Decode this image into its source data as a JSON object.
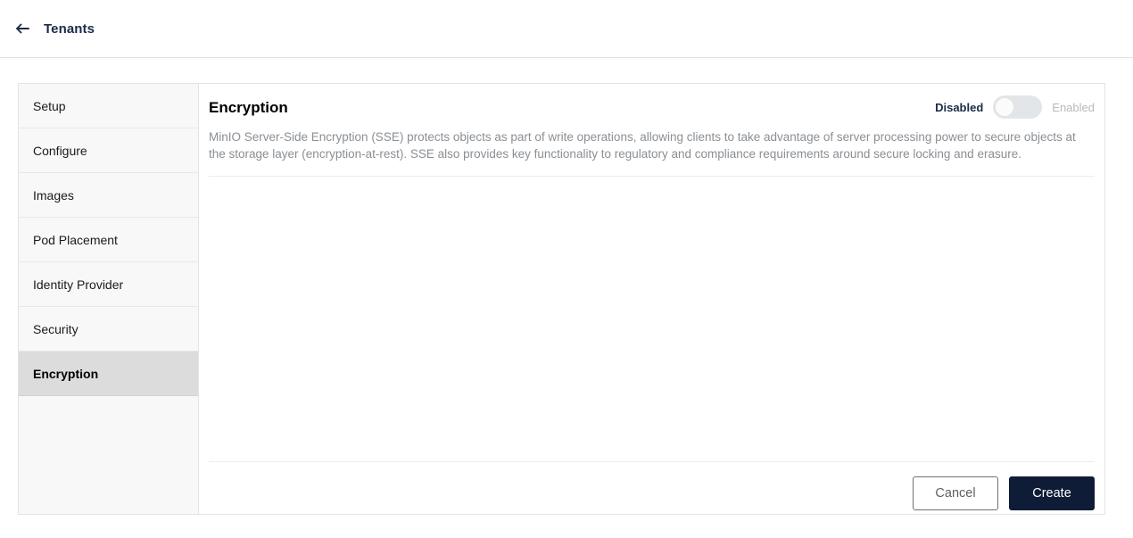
{
  "topbar": {
    "back_icon": "arrow-left-icon",
    "back_label": "Tenants"
  },
  "wizard": {
    "sidebar": {
      "items": [
        {
          "label": "Setup",
          "selected": false
        },
        {
          "label": "Configure",
          "selected": false
        },
        {
          "label": "Images",
          "selected": false
        },
        {
          "label": "Pod Placement",
          "selected": false
        },
        {
          "label": "Identity Provider",
          "selected": false
        },
        {
          "label": "Security",
          "selected": false
        },
        {
          "label": "Encryption",
          "selected": true
        }
      ]
    },
    "panel": {
      "title": "Encryption",
      "toggle": {
        "off_label": "Disabled",
        "on_label": "Enabled",
        "state": "Disabled",
        "checked": false
      },
      "description": "MinIO Server-Side Encryption (SSE) protects objects as part of write operations, allowing clients to take advantage of server processing power to secure objects at the storage layer (encryption-at-rest). SSE also provides key functionality to regulatory and compliance requirements around secure locking and erasure."
    },
    "actions": {
      "cancel_label": "Cancel",
      "create_label": "Create"
    }
  },
  "colors": {
    "brand_navy": "#0f1c38",
    "header_navy": "#1c2b47",
    "selected_nav_bg": "#dcdcdc",
    "sidebar_bg": "#f8f8f8",
    "muted_text": "#8a8f94",
    "border": "#e4e4e4"
  }
}
